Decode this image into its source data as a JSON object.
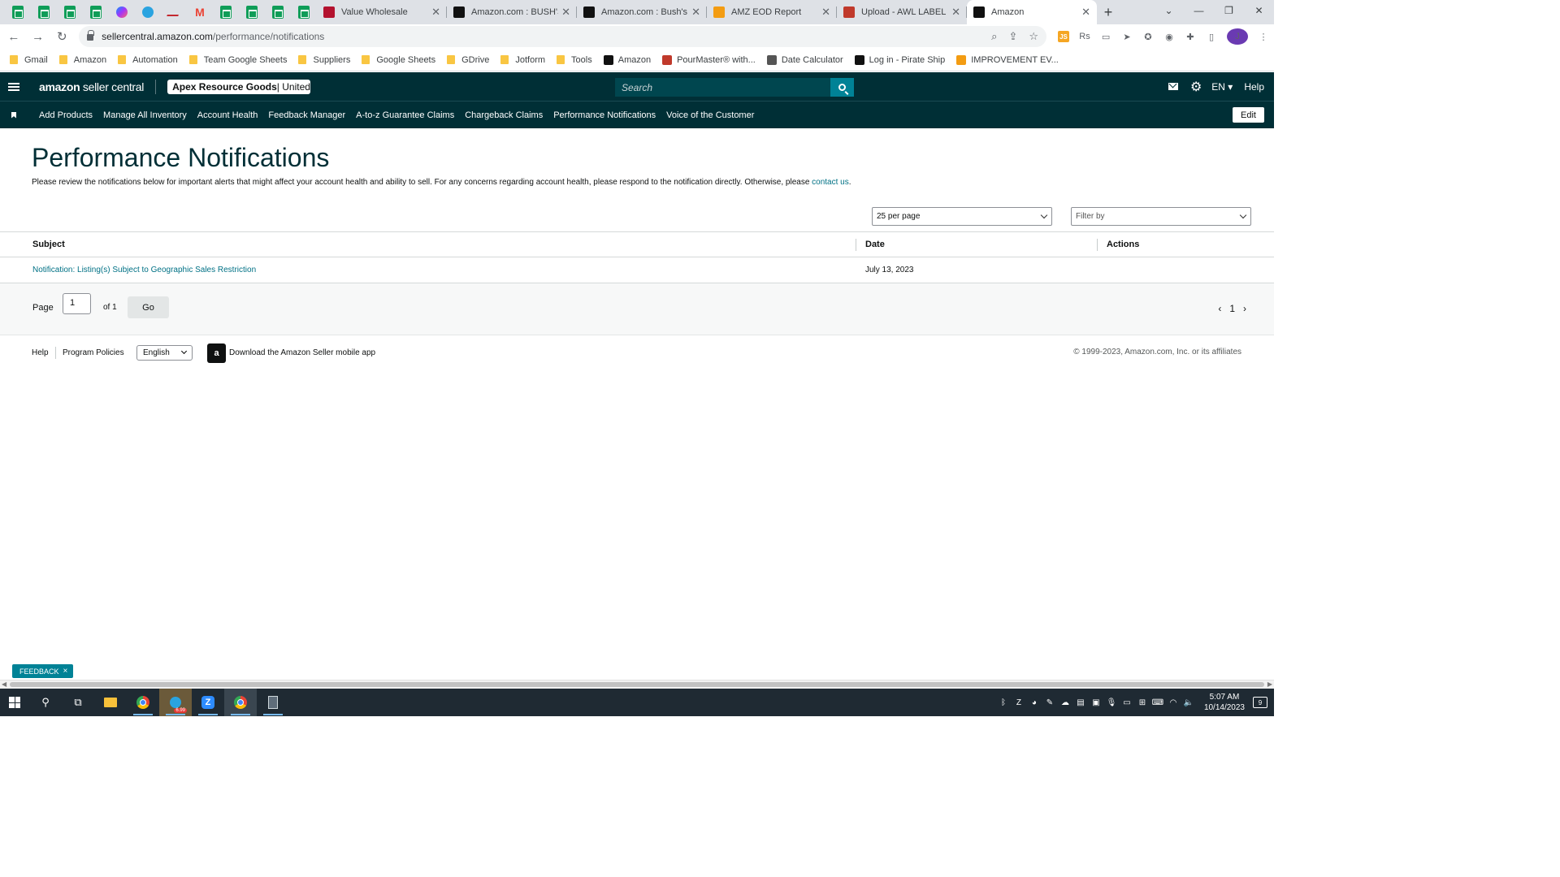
{
  "browser": {
    "tabs": [
      {
        "title": "Value Wholesale",
        "color": "#b3112e"
      },
      {
        "title": "Amazon.com : BUSH'S B",
        "color": "#111111"
      },
      {
        "title": "Amazon.com : Bush's Be",
        "color": "#111111"
      },
      {
        "title": "AMZ EOD Report",
        "color": "#f39c12"
      },
      {
        "title": "Upload - AWL LABEL",
        "color": "#c0392b"
      },
      {
        "title": "Amazon",
        "color": "#111111",
        "active": true
      }
    ],
    "url_host": "sellercentral.amazon.com",
    "url_path": "/performance/notifications",
    "profile_initial": "J",
    "bookmarks": [
      {
        "label": "Gmail",
        "type": "folder"
      },
      {
        "label": "Amazon",
        "type": "folder"
      },
      {
        "label": "Automation",
        "type": "folder"
      },
      {
        "label": "Team Google Sheets",
        "type": "folder"
      },
      {
        "label": "Suppliers",
        "type": "folder"
      },
      {
        "label": "Google Sheets",
        "type": "folder"
      },
      {
        "label": "GDrive",
        "type": "folder"
      },
      {
        "label": "Jotform",
        "type": "folder"
      },
      {
        "label": "Tools",
        "type": "folder"
      },
      {
        "label": "Amazon",
        "type": "site",
        "color": "#111111"
      },
      {
        "label": "PourMaster® with...",
        "type": "site",
        "color": "#c0392b"
      },
      {
        "label": "Date Calculator",
        "type": "site",
        "color": "#555555"
      },
      {
        "label": "Log in - Pirate Ship",
        "type": "site",
        "color": "#111111"
      },
      {
        "label": "IMPROVEMENT EV...",
        "type": "site",
        "color": "#f39c12"
      }
    ]
  },
  "header": {
    "logo_bold": "amazon",
    "logo_light": " seller central",
    "account_name": "Apex Resource Goods",
    "account_region": " | United ...",
    "search_placeholder": "Search",
    "language": "EN",
    "help": "Help"
  },
  "nav": {
    "items": [
      "Add Products",
      "Manage All Inventory",
      "Account Health",
      "Feedback Manager",
      "A-to-z Guarantee Claims",
      "Chargeback Claims",
      "Performance Notifications",
      "Voice of the Customer"
    ],
    "edit_label": "Edit"
  },
  "main": {
    "title": "Performance Notifications",
    "description": "Please review the notifications below for important alerts that might affect your account health and ability to sell. For any concerns regarding account health, please respond to the notification directly. Otherwise, please ",
    "contact_link": "contact us",
    "description_end": ".",
    "per_page": "25 per page",
    "filter": "Filter by",
    "table": {
      "headers": {
        "subject": "Subject",
        "date": "Date",
        "actions": "Actions"
      },
      "rows": [
        {
          "subject": "Notification: Listing(s) Subject to Geographic Sales Restriction",
          "date": "July 13, 2023",
          "actions": ""
        }
      ]
    },
    "pagination": {
      "page_label": "Page",
      "page_value": "1",
      "of_label": "of 1",
      "go_label": "Go",
      "current": "1"
    }
  },
  "footer": {
    "help": "Help",
    "program_policies": "Program Policies",
    "language": "English",
    "app_text": "Download the Amazon Seller mobile app",
    "copyright": "© 1999-2023, Amazon.com, Inc. or its affiliates"
  },
  "feedback_label": "FEEDBACK",
  "taskbar": {
    "time": "5:07 AM",
    "date": "10/14/2023",
    "notification_count": "9",
    "telegram_badge": "6.99"
  },
  "colors": {
    "header_bg": "#002f36",
    "accent": "#008296",
    "link": "#007185"
  }
}
